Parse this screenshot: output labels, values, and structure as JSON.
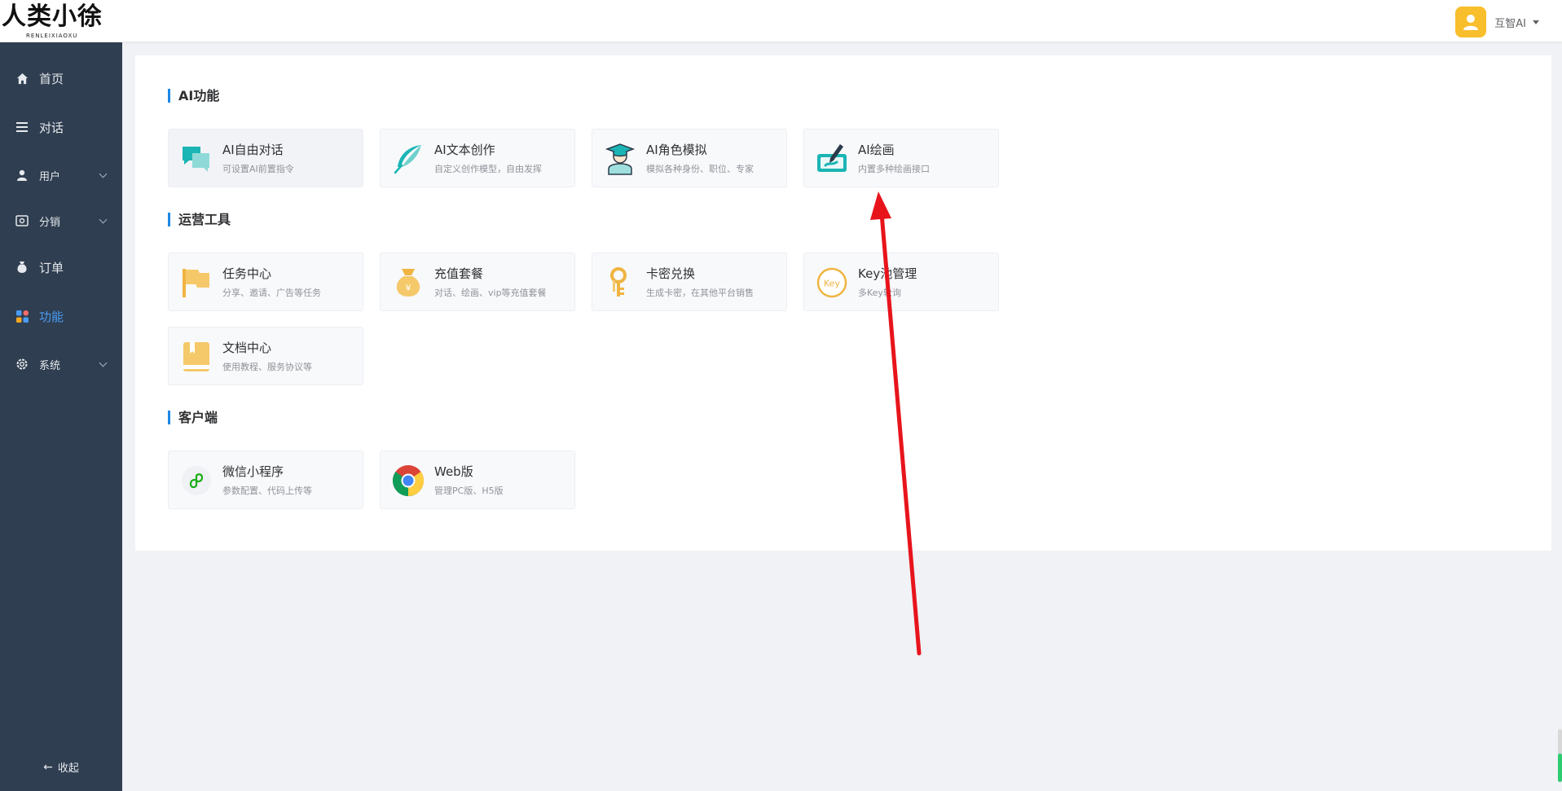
{
  "header": {
    "logo_text": "人类小徐",
    "logo_sub": "RENLEIXIAOXU",
    "user_name": "互智AI"
  },
  "sidebar": {
    "items": [
      {
        "label": "首页",
        "icon": "home-icon"
      },
      {
        "label": "对话",
        "icon": "list-icon"
      },
      {
        "label": "用户",
        "icon": "user-icon",
        "has_children": true
      },
      {
        "label": "分销",
        "icon": "wallet-icon",
        "has_children": true
      },
      {
        "label": "订单",
        "icon": "money-bag-icon"
      },
      {
        "label": "功能",
        "icon": "grid-icon",
        "active": true
      },
      {
        "label": "系统",
        "icon": "gear-icon",
        "has_children": true
      }
    ],
    "collapse_label": "收起"
  },
  "sections": [
    {
      "title": "AI功能",
      "cards": [
        {
          "title": "AI自由对话",
          "desc": "可设置AI前置指令",
          "icon": "chat-bubbles-icon"
        },
        {
          "title": "AI文本创作",
          "desc": "自定义创作模型，自由发挥",
          "icon": "feather-icon"
        },
        {
          "title": "AI角色模拟",
          "desc": "模拟各种身份、职位、专家",
          "icon": "graduate-icon"
        },
        {
          "title": "AI绘画",
          "desc": "内置多种绘画接口",
          "icon": "paint-brush-icon"
        }
      ]
    },
    {
      "title": "运营工具",
      "cards": [
        {
          "title": "任务中心",
          "desc": "分享、邀请、广告等任务",
          "icon": "flag-icon"
        },
        {
          "title": "充值套餐",
          "desc": "对话、绘画、vip等充值套餐",
          "icon": "money-bag-icon"
        },
        {
          "title": "卡密兑换",
          "desc": "生成卡密，在其他平台销售",
          "icon": "key-icon"
        },
        {
          "title": "Key池管理",
          "desc": "多Key轮询",
          "icon": "key-badge-icon",
          "badge_text": "Key"
        },
        {
          "title": "文档中心",
          "desc": "使用教程、服务协议等",
          "icon": "book-icon"
        }
      ]
    },
    {
      "title": "客户端",
      "cards": [
        {
          "title": "微信小程序",
          "desc": "参数配置、代码上传等",
          "icon": "mini-program-icon"
        },
        {
          "title": "Web版",
          "desc": "管理PC版、H5版",
          "icon": "chrome-icon"
        }
      ]
    }
  ],
  "colors": {
    "sidebar_bg": "#2f3e50",
    "active": "#4a9cf5",
    "accent_bar": "#1e88e5",
    "arrow": "#e8141c",
    "teal_icon": "#1bb5b5",
    "orange_icon": "#f5be5a"
  }
}
